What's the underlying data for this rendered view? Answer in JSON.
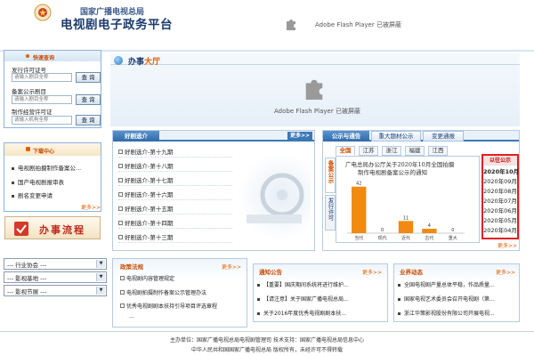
{
  "header": {
    "org": "国家广播电视总局",
    "title": "电视剧电子政务平台",
    "flash_text": "Adobe Flash Player 已被屏蔽"
  },
  "banner": {
    "label_a": "办事",
    "label_b": "大厅",
    "flash_text": "Adobe Flash Player 已被屏蔽"
  },
  "quick_query": {
    "title": "快速查询",
    "fields": [
      {
        "label": "发行许可证号",
        "placeholder": "请输入剧目全称",
        "button": "查 询"
      },
      {
        "label": "备案公示剧目",
        "placeholder": "请输入剧目全称",
        "button": "查 询"
      },
      {
        "label": "制作经营许可证",
        "placeholder": "请输入机构全称",
        "button": "查 询"
      }
    ]
  },
  "downloads": {
    "title": "下载中心",
    "items": [
      "电视剧拍摄制作备案公...",
      "国产电视剧报审表",
      "剧名变更申请"
    ],
    "more": "更多>>"
  },
  "process": {
    "label": "办事流程"
  },
  "selects": [
    "--- 行业协会 ---",
    "--- 影视基地 ---",
    "--- 影视节展 ---"
  ],
  "good_drama": {
    "tab": "好剧选介",
    "more": "更多>>",
    "items": [
      "好剧选介-第十九期",
      "好剧选介-第十八期",
      "好剧选介-第十七期",
      "好剧选介-第十六期",
      "好剧选介-第十五期",
      "好剧选介-第十四期",
      "好剧选介-第十三期"
    ]
  },
  "announce": {
    "tabs": [
      "公示与通告",
      "重大题材公示",
      "变更通报"
    ],
    "regions": [
      "全国",
      "江苏",
      "浙江",
      "福建",
      "江西"
    ],
    "side_tabs": [
      "备案公示",
      "发行许可"
    ],
    "headline_1": "广电总局办公厅关于2020年10月全国拍摄",
    "headline_2": "制作电视剧备案公示的通知",
    "months_title": "以往公示",
    "months": [
      "2020年10月",
      "2020年09月",
      "2020年08月",
      "2020年07月",
      "2020年06月",
      "2020年05月",
      "2020年04月"
    ],
    "more": "更多>>"
  },
  "chart_data": {
    "type": "bar",
    "categories": [
      "当代",
      "现代",
      "近代",
      "古代",
      "重大"
    ],
    "values": [
      42,
      0,
      11,
      4,
      0
    ],
    "ylim": [
      0,
      45
    ],
    "bar_color": "#f08a10"
  },
  "policy": {
    "title": "政策法规",
    "more": "更多>>",
    "items": [
      "电视剧内容管理规定",
      "电视剧拍摄制作备案公示管理办法",
      "优秀电视剧剧本扶持引导项目评选章程",
      "..."
    ]
  },
  "notices": {
    "title": "通知公告",
    "more": "更多>>",
    "items": [
      "【重要】国庆期间系统将进行维护...",
      "【请注意】关于国家广播电视总局...",
      "关于2016年度优秀电视剧剧本扶..."
    ]
  },
  "industry": {
    "title": "业界动态",
    "more": "更多>>",
    "items": [
      "全国电视剧产量总体平稳，作品质量...",
      "国家电视艺术委员会召开电视剧（第...",
      "浙江华策影视股份有限公司开展电视..."
    ]
  },
  "footer": {
    "line1": "主办单位：国家广播电视总局电视剧管理司   技术支持：国家广播电视总局信息中心",
    "line2": "中华人民共和国国家广播电视总局  版权所有，未经许可不得转载"
  }
}
